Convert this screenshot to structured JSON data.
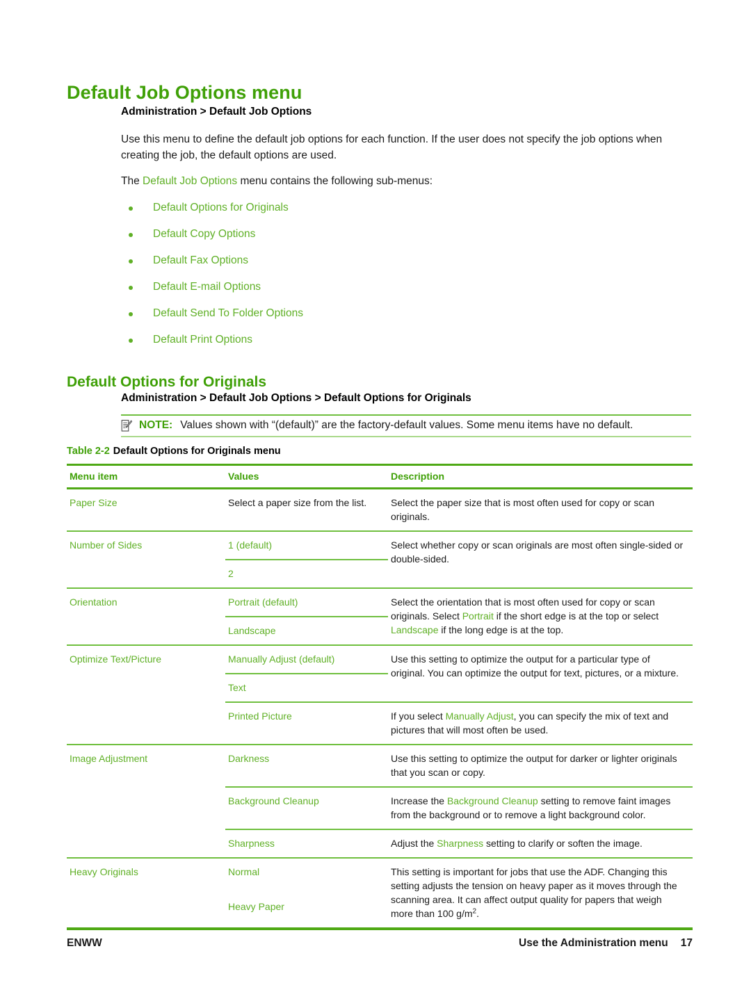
{
  "page": {
    "title": "Default Job Options menu",
    "section_heading": "Default Options for Originals",
    "breadcrumb_1": "Administration > Default Job Options",
    "breadcrumb_2": "Administration > Default Job Options > Default Options for Originals",
    "paragraph_1": "Use this menu to define the default job options for each function. If the user does not specify the job options when creating the job, the default options are used.",
    "paragraph_2_prefix": "The ",
    "paragraph_2_link": "Default Job Options",
    "paragraph_2_suffix": " menu contains the following sub-menus:"
  },
  "submenus": [
    {
      "label": "Default Options for Originals"
    },
    {
      "label": "Default Copy Options"
    },
    {
      "label": "Default Fax Options"
    },
    {
      "label": "Default E-mail Options"
    },
    {
      "label": "Default Send To Folder Options"
    },
    {
      "label": "Default Print Options"
    }
  ],
  "note": {
    "icon": "note-pencil-icon",
    "keyword": "NOTE:",
    "text": "Values shown with “(default)” are the factory-default values. Some menu items have no default."
  },
  "table": {
    "caption_number": "Table 2-2",
    "caption_text": "Default Options for Originals menu",
    "headers": [
      "Menu item",
      "Values",
      "Description"
    ],
    "rows": [
      {
        "menu_item": "Paper Size",
        "blocks": [
          {
            "values": [
              "Select a paper size from the list."
            ],
            "value_color": "black",
            "description": "Select the paper size that is most often used for copy or scan originals."
          }
        ]
      },
      {
        "menu_item": "Number of Sides",
        "blocks": [
          {
            "values": [
              "1 (default)",
              "2"
            ],
            "description": "Select whether copy or scan originals are most often single-sided or double-sided."
          }
        ]
      },
      {
        "menu_item": "Orientation",
        "blocks": [
          {
            "values": [
              "Portrait (default)",
              "Landscape"
            ],
            "description_parts": [
              {
                "t": "Select the orientation that is most often used for copy or scan originals. Select ",
                "g": false
              },
              {
                "t": "Portrait",
                "g": true
              },
              {
                "t": " if the short edge is at the top or select ",
                "g": false
              },
              {
                "t": "Landscape",
                "g": true
              },
              {
                "t": " if the long edge is at the top.",
                "g": false
              }
            ]
          }
        ]
      },
      {
        "menu_item": "Optimize Text/Picture",
        "blocks": [
          {
            "values": [
              "Manually Adjust (default)",
              "Text"
            ],
            "description": "Use this setting to optimize the output for a particular type of original. You can optimize the output for text, pictures, or a mixture."
          },
          {
            "values": [
              "Printed Picture"
            ],
            "description_parts": [
              {
                "t": "If you select ",
                "g": false
              },
              {
                "t": "Manually Adjust",
                "g": true
              },
              {
                "t": ", you can specify the mix of text and pictures that will most often be used.",
                "g": false
              }
            ]
          }
        ]
      },
      {
        "menu_item": "Image Adjustment",
        "blocks": [
          {
            "values": [
              "Darkness"
            ],
            "description": "Use this setting to optimize the output for darker or lighter originals that you scan or copy."
          },
          {
            "values": [
              "Background Cleanup"
            ],
            "description_parts": [
              {
                "t": "Increase the ",
                "g": false
              },
              {
                "t": "Background Cleanup",
                "g": true
              },
              {
                "t": " setting to remove faint images from the background or to remove a light background color.",
                "g": false
              }
            ]
          },
          {
            "values": [
              "Sharpness"
            ],
            "description_parts": [
              {
                "t": "Adjust the ",
                "g": false
              },
              {
                "t": "Sharpness",
                "g": true
              },
              {
                "t": " setting to clarify or soften the image.",
                "g": false
              }
            ]
          }
        ]
      },
      {
        "menu_item": "Heavy Originals",
        "blocks": [
          {
            "values": [
              "Normal",
              "Heavy Paper"
            ],
            "no_inner_rule": true,
            "description_html": "This setting is important for jobs that use the ADF. Changing this setting adjusts the tension on heavy paper as it moves through the scanning area. It can affect output quality for papers that weigh more than 100 g/m<sup>2</sup>."
          }
        ]
      }
    ]
  },
  "footer": {
    "left": "ENWW",
    "right": "Use the Administration menu",
    "page_number": "17"
  },
  "colors": {
    "heading_green": "#3FA007",
    "link_green": "#5FB026",
    "rule_green": "#4FA915",
    "rule_light_green": "#6FBF3E"
  }
}
